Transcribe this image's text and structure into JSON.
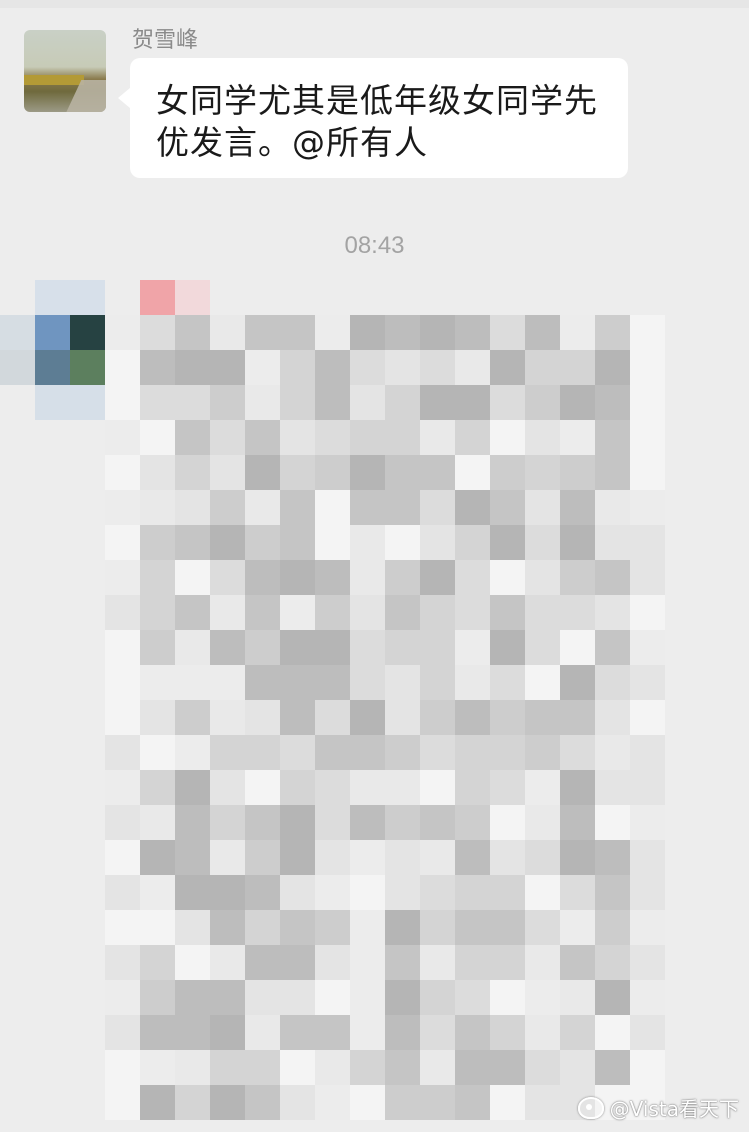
{
  "chat": {
    "message1": {
      "sender": "贺雪峰",
      "text_line1": "女同学尤其是低年级女同学先",
      "text_line2": "优发言。@所有人"
    },
    "timestamp": "08:43"
  },
  "watermark": {
    "text": "@Vista看天下",
    "icon": "weibo-icon"
  },
  "colors": {
    "background": "#ededed",
    "bubble": "#ffffff",
    "timestamp_text": "#a3a3a3",
    "sender_text": "#8a8a8a"
  }
}
